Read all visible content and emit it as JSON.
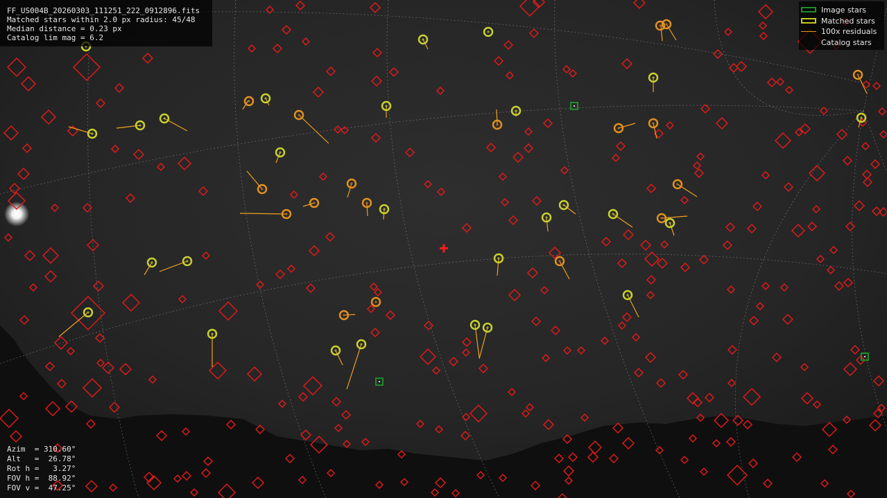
{
  "header": {
    "filename": "FF_US004B_20260303_111251_222_0912896.fits",
    "matched_line": "Matched stars within 2.0 px radius: 45/48",
    "median_line": "Median distance = 0.23 px",
    "limmag_line": "Catalog lim mag = 6.2"
  },
  "legend": {
    "items": [
      {
        "label": "Image stars",
        "color": "#1e8c2a"
      },
      {
        "label": "Matched stars",
        "color": "#c8c820"
      },
      {
        "label": "100x residuals",
        "color": "#e89a1a"
      },
      {
        "label": "Catalog stars",
        "color": "#e01a1a"
      }
    ]
  },
  "pointing": {
    "azim": "Azim  = 310.60°",
    "alt": "Alt   =  26.78°",
    "roth": "Rot h =   3.27°",
    "fovh": "FOV h =  88.92°",
    "fovv": "FOV v =  47.25°"
  },
  "colors": {
    "catalog": "#e01a1a",
    "matched_outer": "#e09020",
    "matched_inner": "#c8d030",
    "residual": "#f0a020",
    "image_star": "#1e8c2a",
    "grid": "#9a9a9a"
  }
}
